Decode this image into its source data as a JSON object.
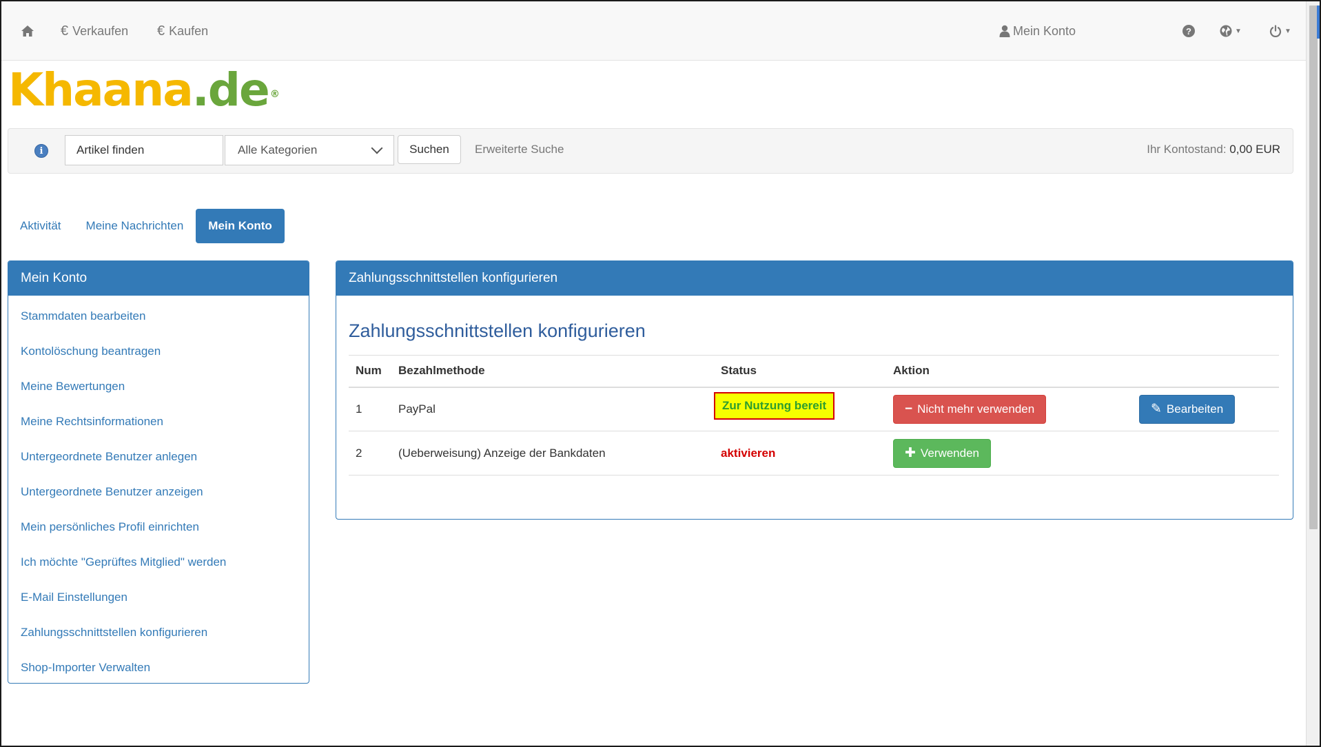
{
  "nav": {
    "home_icon": "home-icon",
    "sell_label": "Verkaufen",
    "buy_label": "Kaufen",
    "currency_glyph": "€",
    "account_label": "Mein Konto",
    "help_glyph": "?",
    "user_glyph": "👤",
    "globe_glyph": "🌐",
    "power_glyph": "⏻",
    "caret_glyph": "▼"
  },
  "logo": {
    "part1": "Khaana",
    "part2": ".de",
    "reg": "®"
  },
  "search": {
    "info_glyph": "i",
    "input_value": "Artikel finden",
    "category_value": "Alle Kategorien",
    "button_label": "Suchen",
    "advanced_label": "Erweiterte Suche",
    "balance_label": "Ihr Kontostand:",
    "balance_value": "0,00 EUR"
  },
  "tabs": [
    {
      "label": "Aktivität",
      "active": false
    },
    {
      "label": "Meine Nachrichten",
      "active": false
    },
    {
      "label": "Mein Konto",
      "active": true
    }
  ],
  "sidebar": {
    "title": "Mein Konto",
    "items": [
      "Stammdaten bearbeiten",
      "Kontolöschung beantragen",
      "Meine Bewertungen",
      "Meine Rechtsinformationen",
      "Untergeordnete Benutzer anlegen",
      "Untergeordnete Benutzer anzeigen",
      "Mein persönliches Profil einrichten",
      "Ich möchte \"Geprüftes Mitglied\" werden",
      "E-Mail Einstellungen",
      "Zahlungsschnittstellen konfigurieren",
      "Shop-Importer Verwalten"
    ]
  },
  "main": {
    "panel_title": "Zahlungsschnittstellen konfigurieren",
    "heading": "Zahlungsschnittstellen konfigurieren",
    "columns": [
      "Num",
      "Bezahlmethode",
      "Status",
      "Aktion"
    ],
    "rows": [
      {
        "num": "1",
        "method": "PayPal",
        "status": "Zur Nutzung bereit",
        "action_label": "Nicht mehr verwenden",
        "action_glyph": "−",
        "edit_label": "Bearbeiten",
        "edit_glyph": "✎"
      },
      {
        "num": "2",
        "method": "(Ueberweisung) Anzeige der Bankdaten",
        "status": "aktivieren",
        "action_label": "Verwenden",
        "action_glyph": "✚"
      }
    ]
  },
  "colors": {
    "primary": "#337ab7",
    "danger": "#d9534f",
    "success": "#5cb85c",
    "logo_yellow": "#f5b800",
    "logo_green": "#6aa63c"
  }
}
